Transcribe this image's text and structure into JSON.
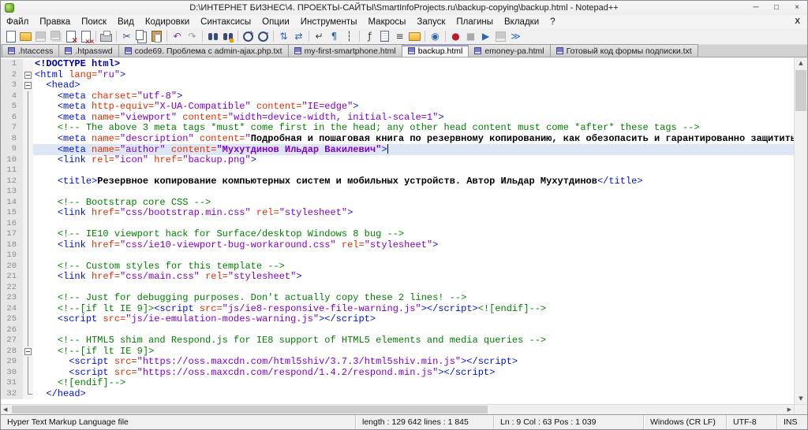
{
  "window": {
    "title": "D:\\ИНТЕРНЕТ БИЗНЕС\\4. ПРОЕКТЫ-САЙТЫ\\SmartInfoProjects.ru\\backup-copying\\backup.html - Notepad++",
    "controls": {
      "minimize": "─",
      "maximize": "□",
      "close": "×"
    }
  },
  "menu": {
    "items": [
      {
        "id": "file",
        "label": "Файл"
      },
      {
        "id": "edit",
        "label": "Правка"
      },
      {
        "id": "search",
        "label": "Поиск"
      },
      {
        "id": "view",
        "label": "Вид"
      },
      {
        "id": "encoding",
        "label": "Кодировки"
      },
      {
        "id": "syntax",
        "label": "Синтаксисы"
      },
      {
        "id": "settings",
        "label": "Опции"
      },
      {
        "id": "tools",
        "label": "Инструменты"
      },
      {
        "id": "macro",
        "label": "Макросы"
      },
      {
        "id": "run",
        "label": "Запуск"
      },
      {
        "id": "plugins",
        "label": "Плагины"
      },
      {
        "id": "tabs",
        "label": "Вкладки"
      },
      {
        "id": "help",
        "label": "?"
      }
    ],
    "close_doc_label": "X"
  },
  "toolbar": {
    "icons": [
      {
        "name": "new-file",
        "kind": "paper"
      },
      {
        "name": "open-file",
        "kind": "folder"
      },
      {
        "name": "save-file",
        "kind": "floppy",
        "disabled": true
      },
      {
        "name": "save-all",
        "kind": "floppy2",
        "disabled": true
      },
      {
        "name": "close-file",
        "kind": "paper-x"
      },
      {
        "name": "close-all",
        "kind": "paper-xx"
      },
      {
        "name": "print",
        "kind": "printer",
        "sep": true
      },
      {
        "name": "cut",
        "glyph": "✂",
        "color": "#44506e",
        "sep": true
      },
      {
        "name": "copy",
        "kind": "copy"
      },
      {
        "name": "paste",
        "kind": "paste"
      },
      {
        "name": "undo",
        "glyph": "↶",
        "color": "#7a2ea0",
        "sep": true
      },
      {
        "name": "redo",
        "glyph": "↷",
        "color": "#9a9a9a"
      },
      {
        "name": "find",
        "kind": "binoc",
        "sep": true
      },
      {
        "name": "replace",
        "kind": "binoc2"
      },
      {
        "name": "zoom-in",
        "kind": "zoomin",
        "sep": true
      },
      {
        "name": "zoom-out",
        "kind": "zoomout"
      },
      {
        "name": "sync-vertical",
        "glyph": "⇅",
        "color": "#2b62b8",
        "sep": true
      },
      {
        "name": "sync-horizontal",
        "glyph": "⇄",
        "color": "#2b62b8"
      },
      {
        "name": "word-wrap",
        "glyph": "↵",
        "color": "#3a3a3a",
        "sep": true
      },
      {
        "name": "show-all-characters",
        "glyph": "¶",
        "color": "#2b62b8"
      },
      {
        "name": "indent-guide",
        "glyph": "┆",
        "color": "#3a3a3a"
      },
      {
        "name": "function-list",
        "glyph": "ƒ",
        "color": "#3a3a3a",
        "sep": true
      },
      {
        "name": "document-map",
        "kind": "docmap"
      },
      {
        "name": "document-list",
        "glyph": "≡",
        "color": "#3a3a3a"
      },
      {
        "name": "folder-as-workspace",
        "kind": "folder"
      },
      {
        "name": "monitoring",
        "glyph": "◉",
        "color": "#2b62b8",
        "sep": true
      },
      {
        "name": "record-macro",
        "glyph": "●",
        "color": "#c01828",
        "sep": true
      },
      {
        "name": "stop-recording",
        "glyph": "■",
        "color": "#2a2a2a",
        "disabled": true
      },
      {
        "name": "playback-macro",
        "glyph": "▶",
        "color": "#2b62b8"
      },
      {
        "name": "save-recorded-macro",
        "kind": "floppy",
        "disabled": true
      },
      {
        "name": "run-macro-multiple-times",
        "glyph": "≫",
        "color": "#2b62b8"
      }
    ]
  },
  "tabs": [
    {
      "id": "htaccess",
      "label": ".htaccess",
      "active": false
    },
    {
      "id": "htpasswd",
      "label": ".htpasswd",
      "active": false
    },
    {
      "id": "code69",
      "label": "code69. Проблема с admin-ajax.php.txt",
      "active": false
    },
    {
      "id": "my-first-smartphone",
      "label": "my-first-smartphone.html",
      "active": false
    },
    {
      "id": "backup",
      "label": "backup.html",
      "active": true
    },
    {
      "id": "emoney-pa",
      "label": "emoney-pa.html",
      "active": false
    },
    {
      "id": "subscription-form",
      "label": "Готовый код формы подписки.txt",
      "active": false
    }
  ],
  "editor": {
    "current_line": 9,
    "caret_line": 9,
    "lines": [
      {
        "n": 1,
        "fold": "",
        "segs": [
          [
            "doct",
            "<!DOCTYPE html>"
          ]
        ]
      },
      {
        "n": 2,
        "fold": "box",
        "segs": [
          [
            "tag",
            "<html "
          ],
          [
            "attr",
            "lang="
          ],
          [
            "val",
            "\"ru\""
          ],
          [
            "tag",
            ">"
          ]
        ]
      },
      {
        "n": 3,
        "fold": "box",
        "segs": [
          [
            "txt",
            "  "
          ],
          [
            "tag",
            "<head>"
          ]
        ]
      },
      {
        "n": 4,
        "fold": "line",
        "segs": [
          [
            "txt",
            "    "
          ],
          [
            "tag",
            "<meta "
          ],
          [
            "attr",
            "charset="
          ],
          [
            "val",
            "\"utf-8\""
          ],
          [
            "tag",
            ">"
          ]
        ]
      },
      {
        "n": 5,
        "fold": "line",
        "segs": [
          [
            "txt",
            "    "
          ],
          [
            "tag",
            "<meta "
          ],
          [
            "attr",
            "http-equiv="
          ],
          [
            "val",
            "\"X-UA-Compatible\" "
          ],
          [
            "attr",
            "content="
          ],
          [
            "val",
            "\"IE=edge\""
          ],
          [
            "tag",
            ">"
          ]
        ]
      },
      {
        "n": 6,
        "fold": "line",
        "segs": [
          [
            "txt",
            "    "
          ],
          [
            "tag",
            "<meta "
          ],
          [
            "attr",
            "name="
          ],
          [
            "val",
            "\"viewport\" "
          ],
          [
            "attr",
            "content="
          ],
          [
            "val",
            "\"width=device-width, initial-scale=1\""
          ],
          [
            "tag",
            ">"
          ]
        ]
      },
      {
        "n": 7,
        "fold": "line",
        "segs": [
          [
            "txt",
            "    "
          ],
          [
            "cmt",
            "<!-- The above 3 meta tags *must* come first in the head; any other head content must come *after* these tags -->"
          ]
        ]
      },
      {
        "n": 8,
        "fold": "line",
        "segs": [
          [
            "txt",
            "    "
          ],
          [
            "tag",
            "<meta "
          ],
          [
            "attr",
            "name="
          ],
          [
            "val",
            "\"description\" "
          ],
          [
            "attr",
            "content="
          ],
          [
            "val",
            "\""
          ],
          [
            "txtb",
            "Подробная и пошаговая книга по резервному копированию, как обезопасить и гарантированно защитить важную информацию от внез"
          ]
        ]
      },
      {
        "n": 9,
        "fold": "line",
        "segs": [
          [
            "txt",
            "    "
          ],
          [
            "tag",
            "<meta "
          ],
          [
            "attr",
            "name="
          ],
          [
            "val",
            "\"author\" "
          ],
          [
            "attr",
            "content="
          ],
          [
            "valb",
            "\"Мухутдинов Ильдар Вакилевич\""
          ],
          [
            "tag",
            ">"
          ]
        ]
      },
      {
        "n": 10,
        "fold": "line",
        "segs": [
          [
            "txt",
            "    "
          ],
          [
            "tag",
            "<link "
          ],
          [
            "attr",
            "rel="
          ],
          [
            "val",
            "\"icon\" "
          ],
          [
            "attr",
            "href="
          ],
          [
            "val",
            "\"backup.png\""
          ],
          [
            "tag",
            ">"
          ]
        ]
      },
      {
        "n": 11,
        "fold": "line",
        "segs": []
      },
      {
        "n": 12,
        "fold": "line",
        "segs": [
          [
            "txt",
            "    "
          ],
          [
            "tag",
            "<title>"
          ],
          [
            "txtb",
            "Резервное копирование компьютерных систем и мобильных устройств. Автор Ильдар Мухутдинов"
          ],
          [
            "tag",
            "</title>"
          ]
        ]
      },
      {
        "n": 13,
        "fold": "line",
        "segs": []
      },
      {
        "n": 14,
        "fold": "line",
        "segs": [
          [
            "txt",
            "    "
          ],
          [
            "cmt",
            "<!-- Bootstrap core CSS -->"
          ]
        ]
      },
      {
        "n": 15,
        "fold": "line",
        "segs": [
          [
            "txt",
            "    "
          ],
          [
            "tag",
            "<link "
          ],
          [
            "attr",
            "href="
          ],
          [
            "val",
            "\"css/bootstrap.min.css\" "
          ],
          [
            "attr",
            "rel="
          ],
          [
            "val",
            "\"stylesheet\""
          ],
          [
            "tag",
            ">"
          ]
        ]
      },
      {
        "n": 16,
        "fold": "line",
        "segs": []
      },
      {
        "n": 17,
        "fold": "line",
        "segs": [
          [
            "txt",
            "    "
          ],
          [
            "cmt",
            "<!-- IE10 viewport hack for Surface/desktop Windows 8 bug -->"
          ]
        ]
      },
      {
        "n": 18,
        "fold": "line",
        "segs": [
          [
            "txt",
            "    "
          ],
          [
            "tag",
            "<link "
          ],
          [
            "attr",
            "href="
          ],
          [
            "val",
            "\"css/ie10-viewport-bug-workaround.css\" "
          ],
          [
            "attr",
            "rel="
          ],
          [
            "val",
            "\"stylesheet\""
          ],
          [
            "tag",
            ">"
          ]
        ]
      },
      {
        "n": 19,
        "fold": "line",
        "segs": []
      },
      {
        "n": 20,
        "fold": "line",
        "segs": [
          [
            "txt",
            "    "
          ],
          [
            "cmt",
            "<!-- Custom styles for this template -->"
          ]
        ]
      },
      {
        "n": 21,
        "fold": "line",
        "segs": [
          [
            "txt",
            "    "
          ],
          [
            "tag",
            "<link "
          ],
          [
            "attr",
            "href="
          ],
          [
            "val",
            "\"css/main.css\" "
          ],
          [
            "attr",
            "rel="
          ],
          [
            "val",
            "\"stylesheet\""
          ],
          [
            "tag",
            ">"
          ]
        ]
      },
      {
        "n": 22,
        "fold": "line",
        "segs": []
      },
      {
        "n": 23,
        "fold": "line",
        "segs": [
          [
            "txt",
            "    "
          ],
          [
            "cmt",
            "<!-- Just for debugging purposes. Don't actually copy these 2 lines! -->"
          ]
        ]
      },
      {
        "n": 24,
        "fold": "line",
        "segs": [
          [
            "txt",
            "    "
          ],
          [
            "cmt",
            "<!--[if lt IE 9]>"
          ],
          [
            "tag",
            "<script "
          ],
          [
            "attr",
            "src="
          ],
          [
            "val",
            "\"js/ie8-responsive-file-warning.js\""
          ],
          [
            "tag",
            "></script>"
          ],
          [
            "cmt",
            "<![endif]-->"
          ]
        ]
      },
      {
        "n": 25,
        "fold": "line",
        "segs": [
          [
            "txt",
            "    "
          ],
          [
            "tag",
            "<script "
          ],
          [
            "attr",
            "src="
          ],
          [
            "val",
            "\"js/ie-emulation-modes-warning.js\""
          ],
          [
            "tag",
            "></script>"
          ]
        ]
      },
      {
        "n": 26,
        "fold": "line",
        "segs": []
      },
      {
        "n": 27,
        "fold": "line",
        "segs": [
          [
            "txt",
            "    "
          ],
          [
            "cmt",
            "<!-- HTML5 shim and Respond.js for IE8 support of HTML5 elements and media queries -->"
          ]
        ]
      },
      {
        "n": 28,
        "fold": "box",
        "segs": [
          [
            "txt",
            "    "
          ],
          [
            "cmt",
            "<!--[if lt IE 9]>"
          ]
        ]
      },
      {
        "n": 29,
        "fold": "line",
        "segs": [
          [
            "txt",
            "      "
          ],
          [
            "tag",
            "<script "
          ],
          [
            "attr",
            "src="
          ],
          [
            "val",
            "\"https://oss.maxcdn.com/html5shiv/3.7.3/html5shiv.min.js\""
          ],
          [
            "tag",
            "></script>"
          ]
        ]
      },
      {
        "n": 30,
        "fold": "line",
        "segs": [
          [
            "txt",
            "      "
          ],
          [
            "tag",
            "<script "
          ],
          [
            "attr",
            "src="
          ],
          [
            "val",
            "\"https://oss.maxcdn.com/respond/1.4.2/respond.min.js\""
          ],
          [
            "tag",
            "></script>"
          ]
        ]
      },
      {
        "n": 31,
        "fold": "line",
        "segs": [
          [
            "txt",
            "    "
          ],
          [
            "cmt",
            "<![endif]-->"
          ]
        ]
      },
      {
        "n": 32,
        "fold": "corner",
        "segs": [
          [
            "txt",
            "  "
          ],
          [
            "tag",
            "</head>"
          ]
        ]
      }
    ]
  },
  "status_bar": {
    "doc_type": "Hyper Text Markup Language file",
    "length_lines": "length : 129 642  lines : 1 845",
    "position": "Ln : 9   Col : 63   Pos : 1 039",
    "eol": "Windows (CR LF)",
    "encoding": "UTF-8",
    "insert_mode": "INS"
  },
  "colors": {
    "syntax_tag": "#0010d8",
    "syntax_attribute": "#e62e00",
    "syntax_value": "#8000d0",
    "syntax_comment": "#008000",
    "syntax_text": "#000000",
    "current_line_bg": "#dce6f5",
    "gutter_bg": "#e6e6e6",
    "statusbar_bg": "#f0f0f0"
  }
}
